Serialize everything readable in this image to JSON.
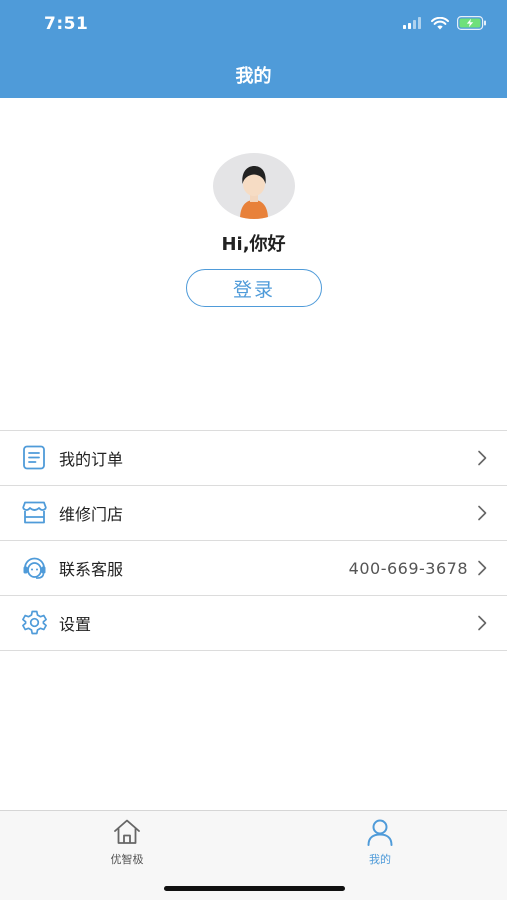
{
  "status_bar": {
    "time": "7:51",
    "icons": [
      "signal-icon",
      "wifi-icon",
      "battery-charging-icon"
    ]
  },
  "header": {
    "title": "我的"
  },
  "profile": {
    "greeting": "Hi,你好",
    "login_label": "登录"
  },
  "menu": {
    "items": [
      {
        "label": "我的订单",
        "value": "",
        "icon": "orders-icon"
      },
      {
        "label": "维修门店",
        "value": "",
        "icon": "store-icon"
      },
      {
        "label": "联系客服",
        "value": "400-669-3678",
        "icon": "customer-service-icon"
      },
      {
        "label": "设置",
        "value": "",
        "icon": "settings-icon"
      }
    ]
  },
  "tabbar": {
    "tabs": [
      {
        "label": "优智极",
        "icon": "home-icon",
        "active": false
      },
      {
        "label": "我的",
        "icon": "user-icon",
        "active": true
      }
    ]
  },
  "colors": {
    "accent": "#4f9bd9",
    "header_bg": "#4f9bd9",
    "avatar_shirt": "#e8813a"
  }
}
